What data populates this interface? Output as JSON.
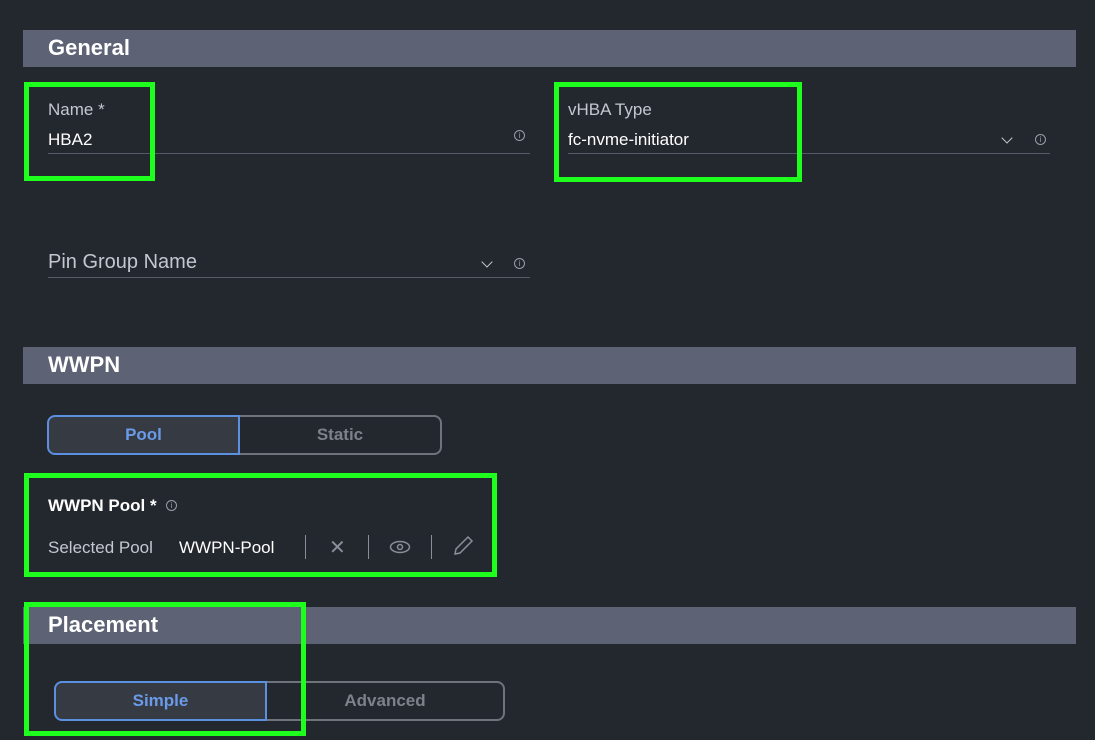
{
  "general": {
    "title": "General",
    "name": {
      "label": "Name *",
      "value": "HBA2"
    },
    "vhba_type": {
      "label": "vHBA Type",
      "value": "fc-nvme-initiator"
    },
    "pin_group": {
      "label": "Pin Group Name"
    }
  },
  "wwpn": {
    "title": "WWPN",
    "toggle": [
      "Pool",
      "Static"
    ],
    "selected": "Pool",
    "pool_label": "WWPN Pool *",
    "selected_label": "Selected Pool",
    "selected_value": "WWPN-Pool"
  },
  "placement": {
    "title": "Placement",
    "toggle": [
      "Simple",
      "Advanced"
    ],
    "selected": "Simple"
  },
  "colors": {
    "highlight": "#1eff1e",
    "accent": "#5b8fe0",
    "section": "#5d6274",
    "background": "#23272e"
  }
}
